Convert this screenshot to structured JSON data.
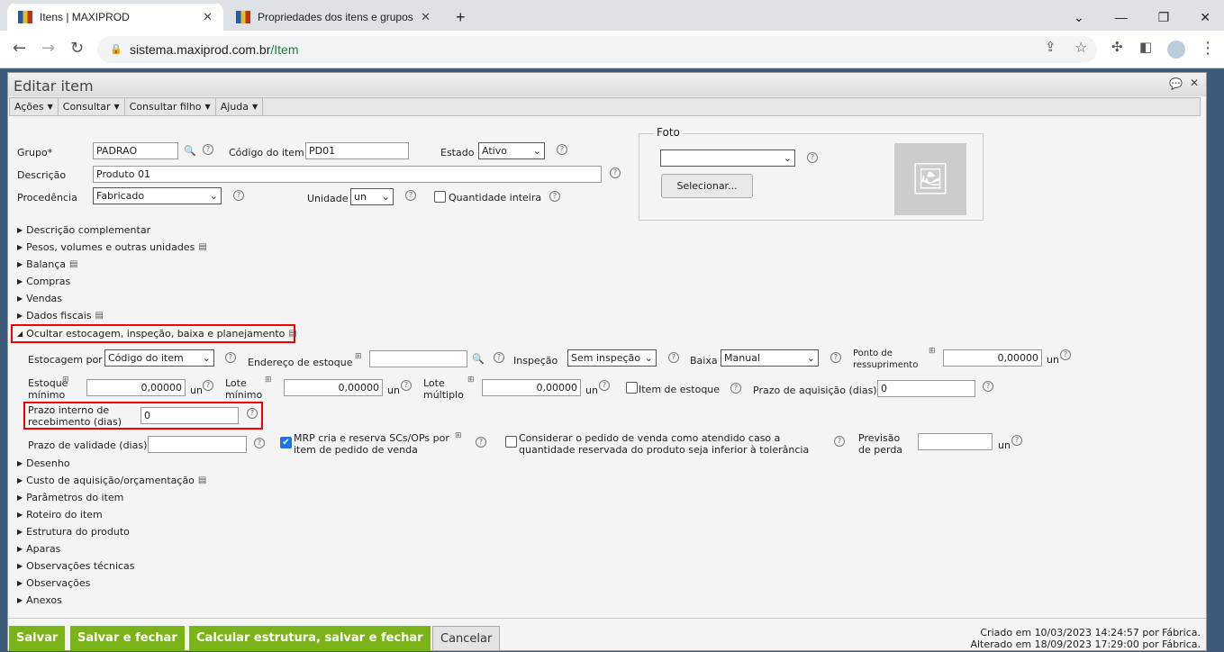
{
  "browser": {
    "tabs": [
      {
        "title": "Itens | MAXIPROD"
      },
      {
        "title": "Propriedades dos itens e grupos"
      }
    ],
    "url_host": "sistema.maxiprod.com.br",
    "url_path": "/Item"
  },
  "panel": {
    "title": "Editar item",
    "menus": [
      "Ações",
      "Consultar",
      "Consultar filho",
      "Ajuda"
    ]
  },
  "form": {
    "grupo_label": "Grupo*",
    "grupo": "PADRAO",
    "codigo_label": "Código do item",
    "codigo": "PD01",
    "estado_label": "Estado",
    "estado": "Ativo",
    "descricao_label": "Descrição",
    "descricao": "Produto 01",
    "procedencia_label": "Procedência",
    "procedencia": "Fabricado",
    "unidade_label": "Unidade",
    "unidade": "un",
    "qtd_inteira_label": "Quantidade inteira",
    "foto_label": "Foto",
    "selecionar_label": "Selecionar..."
  },
  "sections_top": [
    "Descrição complementar",
    "Pesos, volumes e outras unidades",
    "Balança",
    "Compras",
    "Vendas",
    "Dados fiscais"
  ],
  "open_section": "Ocultar estocagem, inspeção, baixa e planejamento",
  "estoque": {
    "estocagem_label": "Estocagem por",
    "estocagem": "Código do item",
    "endereco_label": "Endereço de estoque",
    "inspecao_label": "Inspeção",
    "inspecao": "Sem inspeção",
    "baixa_label": "Baixa",
    "baixa": "Manual",
    "ponto_label1": "Ponto de",
    "ponto_label2": "ressuprimento",
    "ponto": "0,00000",
    "un": "un",
    "est_min_label1": "Estoque",
    "est_min_label2": "mínimo",
    "est_min": "0,00000",
    "lote_min_label1": "Lote",
    "lote_min_label2": "mínimo",
    "lote_min": "0,00000",
    "lote_mult_label1": "Lote",
    "lote_mult_label2": "múltiplo",
    "lote_mult": "0,00000",
    "item_estoque_label": "Item de estoque",
    "prazo_aq_label": "Prazo de aquisição (dias)",
    "prazo_aq": "0",
    "prazo_int_label1": "Prazo interno de",
    "prazo_int_label2": "recebimento (dias)",
    "prazo_int": "0",
    "validade_label": "Prazo de validade (dias)",
    "mrp_label1": "MRP cria e reserva SCs/OPs por",
    "mrp_label2": "item de pedido de venda",
    "considerar_label1": "Considerar o pedido de venda como atendido caso a",
    "considerar_label2": "quantidade reservada do produto seja inferior à tolerância",
    "perda_label1": "Previsão",
    "perda_label2": "de perda"
  },
  "sections_bottom": [
    "Desenho",
    "Custo de aquisição/orçamentação",
    "Parâmetros do item",
    "Roteiro do item",
    "Estrutura do produto",
    "Aparas",
    "Observações técnicas",
    "Observações",
    "Anexos"
  ],
  "footer": {
    "salvar": "Salvar",
    "salvar_fechar": "Salvar e fechar",
    "calcular": "Calcular estrutura, salvar e fechar",
    "cancelar": "Cancelar",
    "criado": "Criado em 10/03/2023 14:24:57 por Fábrica.",
    "alterado": "Alterado em 18/09/2023 17:29:00 por Fábrica."
  }
}
